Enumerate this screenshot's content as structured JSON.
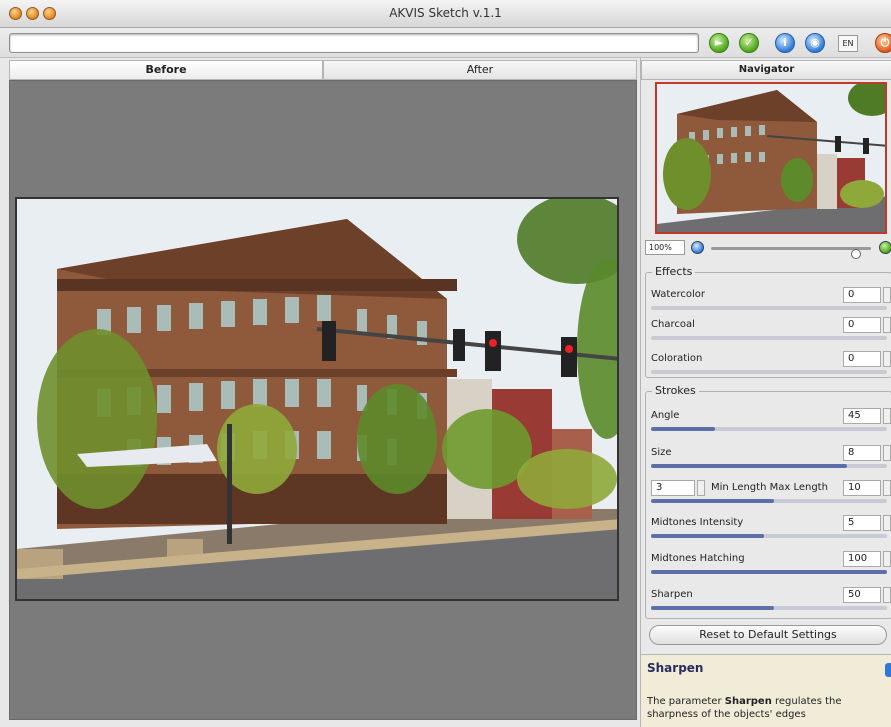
{
  "window": {
    "title": "AKVIS Sketch v.1.1"
  },
  "toolbar": {
    "path_value": "",
    "lang": "EN"
  },
  "tabs": [
    {
      "label": "Before"
    },
    {
      "label": "After"
    }
  ],
  "navigator": {
    "header": "Navigator",
    "zoom": "100%"
  },
  "effects": {
    "title": "Effects",
    "params": [
      {
        "label": "Watercolor",
        "value": "0",
        "level": 0
      },
      {
        "label": "Charcoal",
        "value": "0",
        "level": 0
      },
      {
        "label": "Coloration",
        "value": "0",
        "level": 0
      }
    ]
  },
  "strokes": {
    "title": "Strokes",
    "params": [
      {
        "label": "Angle",
        "value": "45",
        "level": 0.27
      },
      {
        "label": "Size",
        "value": "8",
        "level": 0.83
      },
      {
        "label": "Midtones Intensity",
        "value": "5",
        "level": 0.48
      },
      {
        "label": "Midtones Hatching",
        "value": "100",
        "level": 1.0
      },
      {
        "label": "Sharpen",
        "value": "50",
        "level": 0.52
      }
    ],
    "min_length": "3",
    "minmax_label": "Min Length Max Length",
    "max_length": "10",
    "minmax_level": 0.52
  },
  "reset_label": "Reset to Default Settings",
  "help": {
    "title": "Sharpen",
    "text_prefix": "The parameter ",
    "text_bold": "Sharpen",
    "text_suffix": " regulates the sharpness of the objects' edges"
  },
  "colors": {
    "accent_slider": "#5c6fa8",
    "navigator_frame": "#c0392b"
  },
  "icons": [
    "go-green-icon",
    "check-green-icon",
    "info-blue-icon",
    "globe-blue-icon",
    "power-red-icon"
  ]
}
